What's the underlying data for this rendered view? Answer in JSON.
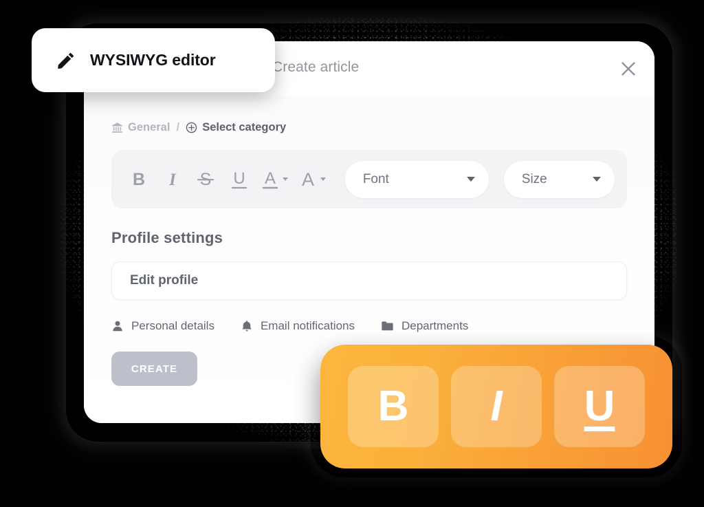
{
  "badge": {
    "label": "WYSIWYG editor",
    "icon": "pencil-icon"
  },
  "header": {
    "title": "Create article",
    "close_icon": "close-icon"
  },
  "breadcrumb": {
    "general": {
      "label": "General",
      "icon": "bank-icon"
    },
    "separator": "/",
    "select_category": {
      "label": "Select category",
      "icon": "plus-circle-icon"
    }
  },
  "toolbar": {
    "buttons": [
      {
        "name": "bold-button",
        "icon": "bold-icon",
        "glyph": "B"
      },
      {
        "name": "italic-button",
        "icon": "italic-icon",
        "glyph": "I"
      },
      {
        "name": "strikethrough-button",
        "icon": "strikethrough-icon",
        "glyph": "S"
      },
      {
        "name": "underline-button",
        "icon": "underline-icon",
        "glyph": "U"
      },
      {
        "name": "text-color-button",
        "icon": "text-color-icon",
        "glyph": "A"
      },
      {
        "name": "highlight-color-button",
        "icon": "highlight-color-icon",
        "glyph": "A"
      }
    ],
    "font_select": {
      "label": "Font",
      "icon": "chevron-down-icon"
    },
    "size_select": {
      "label": "Size",
      "icon": "chevron-down-icon"
    }
  },
  "content": {
    "section_title": "Profile settings",
    "edit_profile_field": {
      "value": "Edit profile",
      "placeholder": "Edit profile"
    },
    "meta": [
      {
        "label": "Personal details",
        "icon": "person-icon"
      },
      {
        "label": "Email notifications",
        "icon": "bell-icon"
      },
      {
        "label": "Departments",
        "icon": "folder-icon"
      }
    ],
    "create_button": "CREATE"
  },
  "floating_toolbar": {
    "buttons": [
      {
        "name": "bold-button",
        "icon": "bold-icon",
        "glyph": "B"
      },
      {
        "name": "italic-button",
        "icon": "italic-icon",
        "glyph": "I"
      },
      {
        "name": "underline-button",
        "icon": "underline-icon",
        "glyph": "U"
      }
    ]
  },
  "colors": {
    "background": "#000000",
    "card": "#ffffff",
    "toolbar_bg": "#f3f3f6",
    "text_muted": "#9095a0",
    "text_dark": "#60646e",
    "accent_orange_light": "#fcb63e",
    "accent_orange_dark": "#f79132",
    "create_button": "#bcc0ca"
  }
}
